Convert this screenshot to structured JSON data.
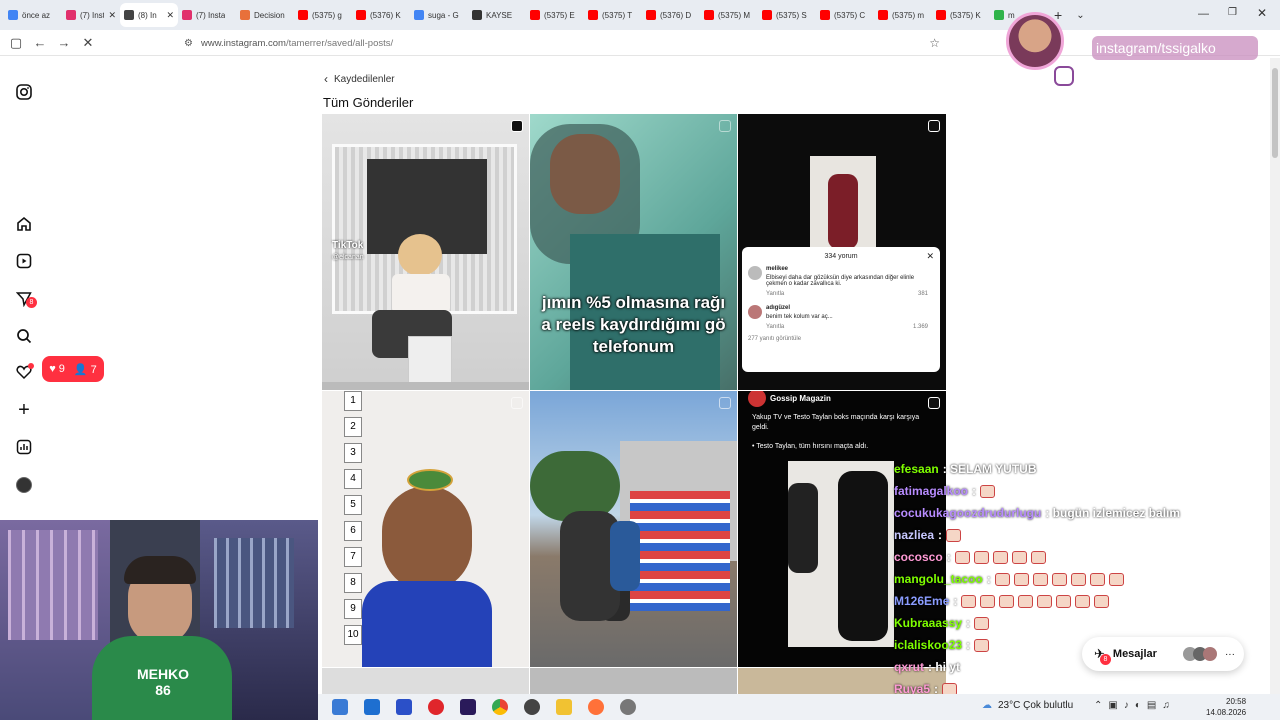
{
  "browser": {
    "tabs": [
      {
        "label": "önce az",
        "color": "#4285f4"
      },
      {
        "label": "(7) Insta",
        "color": "#e1306c"
      },
      {
        "label": "(8) In",
        "color": "#444444"
      },
      {
        "label": "(7) Insta",
        "color": "#e1306c"
      },
      {
        "label": "Decision",
        "color": "#e8703a"
      },
      {
        "label": "(5375) g",
        "color": "#ff0000"
      },
      {
        "label": "(5376) K",
        "color": "#ff0000"
      },
      {
        "label": "suga - G",
        "color": "#4285f4"
      },
      {
        "label": "KAYSE",
        "color": "#333333"
      },
      {
        "label": "(5375) E",
        "color": "#ff0000"
      },
      {
        "label": "(5375) T",
        "color": "#ff0000"
      },
      {
        "label": "(5376) D",
        "color": "#ff0000"
      },
      {
        "label": "(5375) M",
        "color": "#ff0000"
      },
      {
        "label": "(5375) S",
        "color": "#ff0000"
      },
      {
        "label": "(5375) C",
        "color": "#ff0000"
      },
      {
        "label": "(5375) m",
        "color": "#ff0000"
      },
      {
        "label": "(5375) K",
        "color": "#ff0000"
      },
      {
        "label": "m",
        "color": "#2fb34a"
      }
    ],
    "url_host": "www.instagram.com",
    "url_path": "/tamerrer/saved/all-posts/",
    "new_tab": "+",
    "tab_list": "⌄"
  },
  "overlay": {
    "username": "instagram/tssigalko"
  },
  "page": {
    "back_label": "Kaydedilenler",
    "title": "Tüm Gönderiler",
    "notif_likes": "9",
    "notif_follows": "7",
    "messages_badge": "8"
  },
  "posts": {
    "p1_watermark": "TikTok",
    "p1_handle": "@elcanan",
    "p2_caption": "jımın %5 olmasına rağı\na reels kaydırdığımı gö\ntelefonum",
    "p3_comments_title": "334 yorum",
    "p3_c1_user": "melikee",
    "p3_c1_text": "Elbiseyi daha dar gözüksün diye arkasından diğer elinle çekmen o kadar zavallıca ki.",
    "p3_c1_likes": "381",
    "p3_c2_user": "adıgüzel",
    "p3_c2_text": "benim tek kolum var aç...",
    "p3_c2_likes": "1.369",
    "p3_reply": "Yanıtla",
    "p3_more": "277 yanıtı görüntüle",
    "p6_source": "Gossip Magazin",
    "p6_text": "Yakup TV ve Testo Taylan boks maçında karşı karşıya geldi.",
    "p6_text2": "• Testo Taylan, tüm hırsını maçta aldı.",
    "numbers": [
      "1",
      "2",
      "3",
      "4",
      "5",
      "6",
      "7",
      "8",
      "9",
      "10"
    ]
  },
  "chat": [
    {
      "user": "efesaan",
      "msg": ": SELAM YUTUB",
      "color": "#7fff00",
      "emotes": 0
    },
    {
      "user": "fatimagalkoo",
      "msg": ":",
      "color": "#b88cff",
      "emotes": 1
    },
    {
      "user": "cocukukagoozdrudurlugu",
      "msg": ": bugün izlemicez balım",
      "color": "#b88cff",
      "emotes": 0
    },
    {
      "user": "nazliea",
      "msg": ":",
      "color": "#c8c8ff",
      "emotes": 1
    },
    {
      "user": "cocosco",
      "msg": ":",
      "color": "#ff9ad5",
      "emotes": 5
    },
    {
      "user": "mangolu_tacoo",
      "msg": ":",
      "color": "#7fff00",
      "emotes": 7
    },
    {
      "user": "M126Eme",
      "msg": ":",
      "color": "#8a9cff",
      "emotes": 8
    },
    {
      "user": "Kubraaassy",
      "msg": ":",
      "color": "#7fff00",
      "emotes": 1
    },
    {
      "user": "iclaliskoo23",
      "msg": ":",
      "color": "#7fff00",
      "emotes": 1
    },
    {
      "user": "qxrut",
      "msg": ": hi yt",
      "color": "#ff9ad5",
      "emotes": 0
    },
    {
      "user": "Ruya5",
      "msg": ":",
      "color": "#ff9ad5",
      "emotes": 1
    }
  ],
  "messages": {
    "label": "Mesajlar",
    "badge": "8"
  },
  "taskbar": {
    "weather": "23°C  Çok bulutlu",
    "time": "20:58",
    "date": "14.08.2026"
  },
  "webcam": {
    "shirt_text": "MEHKO\n86"
  }
}
